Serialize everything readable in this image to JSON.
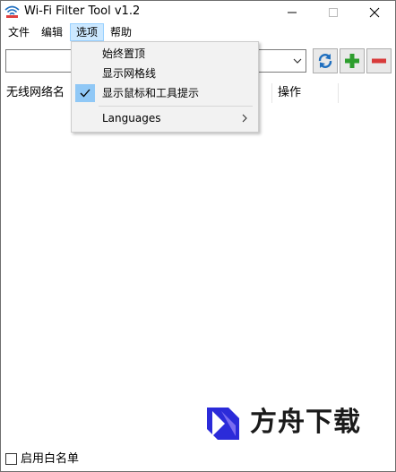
{
  "window": {
    "title": "Wi-Fi Filter Tool v1.2"
  },
  "menubar": {
    "items": [
      {
        "label": "文件"
      },
      {
        "label": "编辑"
      },
      {
        "label": "选项"
      },
      {
        "label": "帮助"
      }
    ]
  },
  "toolbar": {
    "combo_value": "",
    "icons": [
      "refresh-icon",
      "add-icon",
      "remove-icon"
    ]
  },
  "list": {
    "columns": [
      {
        "label": "无线网络名"
      },
      {
        "label": ""
      },
      {
        "label": "操作"
      }
    ]
  },
  "options_menu": {
    "items": [
      {
        "label": "始终置顶",
        "checked": false
      },
      {
        "label": "显示网格线",
        "checked": false
      },
      {
        "label": "显示鼠标和工具提示",
        "checked": true
      },
      {
        "label": "Languages",
        "submenu": true
      }
    ]
  },
  "footer": {
    "whitelist_label": "启用白名单",
    "whitelist_checked": false
  },
  "watermark": {
    "text": "方舟下载"
  },
  "colors": {
    "menu_highlight": "#cce8ff",
    "check_bg": "#90c8f6",
    "add_green": "#2e9e2e",
    "remove_red": "#d83b3b",
    "refresh_blue": "#1f6fbf"
  }
}
